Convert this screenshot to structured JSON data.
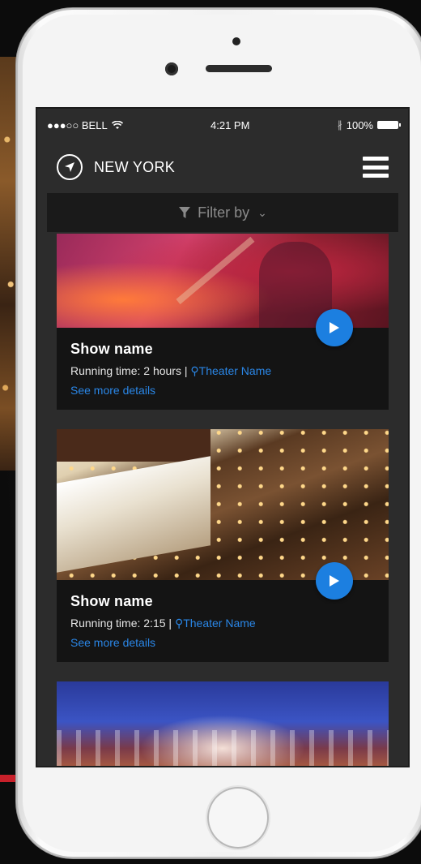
{
  "status_bar": {
    "carrier": "●●●○○ BELL",
    "time": "4:21 PM",
    "bluetooth": "∦",
    "battery": "100%"
  },
  "header": {
    "city": "NEW YORK"
  },
  "filter": {
    "label": "Filter by"
  },
  "shows": [
    {
      "name": "Show name",
      "running_time": "Running time: 2 hours |",
      "theater": "Theater Name",
      "details": "See more details"
    },
    {
      "name": "Show name",
      "running_time": "Running time: 2:15 |",
      "theater": "Theater Name",
      "details": "See more details"
    }
  ],
  "colors": {
    "accent": "#1c7fe0",
    "link": "#2a86e6",
    "screen_bg": "#2c2c2c",
    "card_bg": "#141414"
  },
  "icons": [
    "navigation-arrow-icon",
    "hamburger-menu-icon",
    "filter-funnel-icon",
    "chevron-down-icon",
    "play-icon",
    "map-pin-icon",
    "wifi-icon",
    "bluetooth-icon",
    "battery-icon"
  ]
}
